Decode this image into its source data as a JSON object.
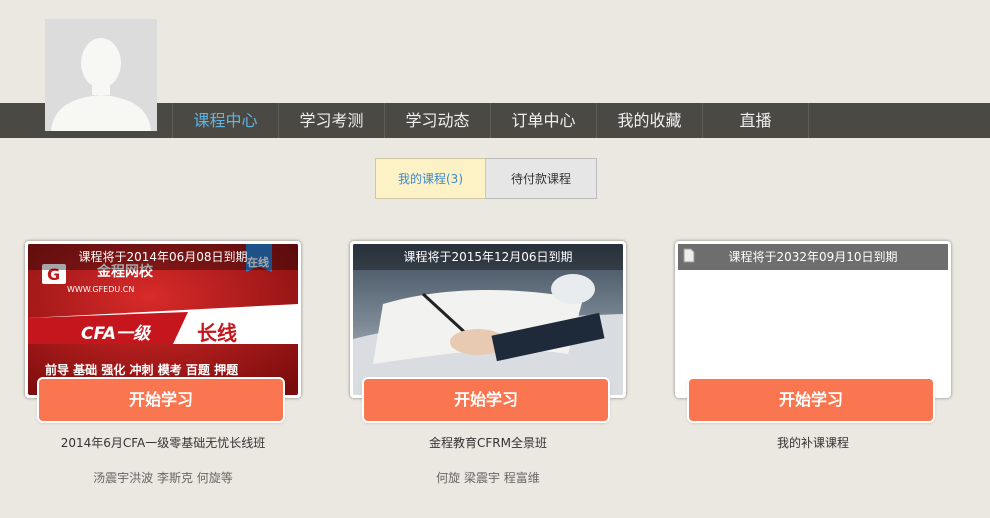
{
  "nav": {
    "items": [
      {
        "label": "课程中心",
        "active": true
      },
      {
        "label": "学习考测"
      },
      {
        "label": "学习动态"
      },
      {
        "label": "订单中心"
      },
      {
        "label": "我的收藏"
      },
      {
        "label": "直播"
      }
    ]
  },
  "tabs": {
    "my_courses": "我的课程(3)",
    "pending": "待付款课程"
  },
  "courses": [
    {
      "expire": "课程将于2014年06月08日到期",
      "button": "开始学习",
      "title": "2014年6月CFA一级零基础无忧长线班",
      "teachers": "汤震宇洪波 李斯克 何旋等",
      "banner": {
        "brand": "金程网校",
        "site": "WWW.GFEDU.CN",
        "ribbon": "在线",
        "course": "CFA一级",
        "type": "长线",
        "stages": "前导 基础 强化 冲刺 模考 百题 押题"
      }
    },
    {
      "expire": "课程将于2015年12月06日到期",
      "button": "开始学习",
      "title": "金程教育CFRM全景班",
      "teachers": "何旋 梁震宇 程富维"
    },
    {
      "expire": "课程将于2032年09月10日到期",
      "button": "开始学习",
      "title": "我的补课课程",
      "teachers": ""
    }
  ],
  "colors": {
    "navbar": "#4a4944",
    "active_nav": "#5fb4e6",
    "button": "#fa7650",
    "background": "#ebe8e1"
  }
}
